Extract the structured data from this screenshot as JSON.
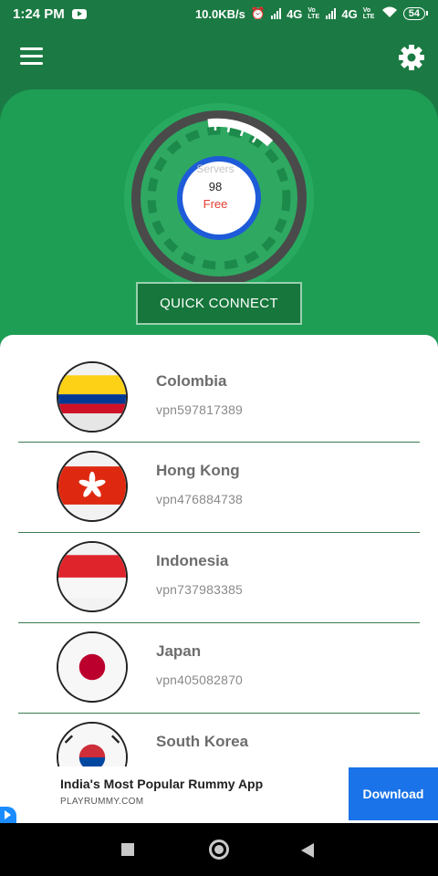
{
  "status_bar": {
    "time": "1:24 PM",
    "speed": "10.0KB/s",
    "net1": "4G",
    "net2": "4G",
    "volte": "Vo LTE",
    "battery": "54"
  },
  "gauge": {
    "label": "Servers",
    "count": "98",
    "tier": "Free"
  },
  "quick_connect_label": "QUICK CONNECT",
  "servers": [
    {
      "country": "Colombia",
      "id": "vpn597817389",
      "flag": "colombia-flag"
    },
    {
      "country": "Hong Kong",
      "id": "vpn476884738",
      "flag": "hong-kong-flag"
    },
    {
      "country": "Indonesia",
      "id": "vpn737983385",
      "flag": "indonesia-flag"
    },
    {
      "country": "Japan",
      "id": "vpn405082870",
      "flag": "japan-flag"
    },
    {
      "country": "South Korea",
      "id": "",
      "flag": "south-korea-flag"
    }
  ],
  "ad": {
    "title": "India's Most Popular Rummy App",
    "domain": "PLAYRUMMY.COM",
    "button": "Download"
  },
  "colors": {
    "primary_dark": "#1b7a43",
    "primary": "#1e9d54",
    "ad_button": "#1a73e8"
  }
}
